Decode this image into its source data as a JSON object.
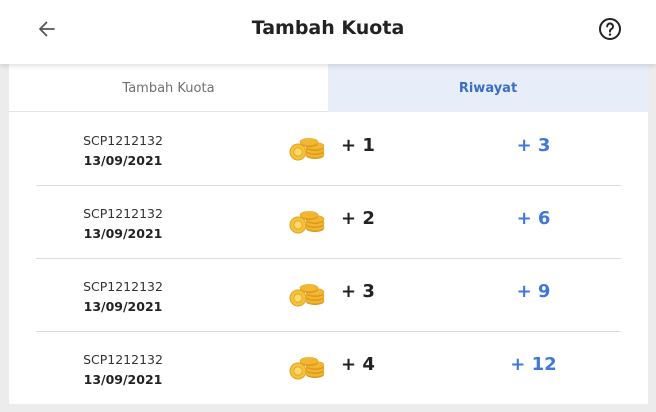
{
  "header": {
    "title": "Tambah Kuota",
    "back_icon": "arrow-left-icon",
    "help_icon": "help-circle-icon"
  },
  "tabs": [
    {
      "label": "Tambah Kuota",
      "active": false
    },
    {
      "label": "Riwayat",
      "active": true
    }
  ],
  "colors": {
    "accent": "#3f78d8",
    "active_tab_bg": "#e8eef9",
    "coin": "#f2b630"
  },
  "history": [
    {
      "ref": "SCP1212132",
      "date": "13/09/2021",
      "icon": "coins-icon",
      "qty": "+ 1",
      "total": "+ 3"
    },
    {
      "ref": "SCP1212132",
      "date": "13/09/2021",
      "icon": "coins-icon",
      "qty": "+ 2",
      "total": "+ 6"
    },
    {
      "ref": "SCP1212132",
      "date": "13/09/2021",
      "icon": "coins-icon",
      "qty": "+ 3",
      "total": "+ 9"
    },
    {
      "ref": "SCP1212132",
      "date": "13/09/2021",
      "icon": "coins-icon",
      "qty": "+ 4",
      "total": "+ 12"
    }
  ]
}
